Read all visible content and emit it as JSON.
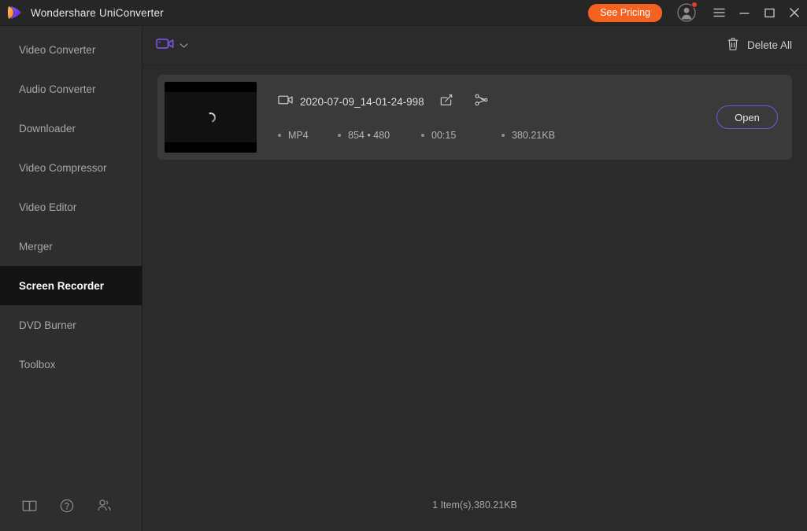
{
  "window": {
    "app_title": "Wondershare UniConverter",
    "logo_icon": "wondershare-play-logo",
    "pricing_label": "See Pricing",
    "avatar_icon": "account-avatar-icon",
    "notification_dot": true,
    "menu_icon": "hamburger-menu-icon",
    "minimize_icon": "minimize-icon",
    "maximize_icon": "maximize-icon",
    "close_icon": "close-icon"
  },
  "sidebar": {
    "items": [
      {
        "label": "Video Converter",
        "active": false
      },
      {
        "label": "Audio Converter",
        "active": false
      },
      {
        "label": "Downloader",
        "active": false
      },
      {
        "label": "Video Compressor",
        "active": false
      },
      {
        "label": "Video Editor",
        "active": false
      },
      {
        "label": "Merger",
        "active": false
      },
      {
        "label": "Screen Recorder",
        "active": true
      },
      {
        "label": "DVD Burner",
        "active": false
      },
      {
        "label": "Toolbox",
        "active": false
      }
    ],
    "footer_icons": [
      {
        "name": "guide-book-icon"
      },
      {
        "name": "help-question-icon"
      },
      {
        "name": "community-users-icon"
      }
    ]
  },
  "toolbar": {
    "recorder_icon": "video-camera-icon",
    "recorder_dropdown_icon": "chevron-down-icon",
    "delete_all_icon": "trash-icon",
    "delete_all_label": "Delete All"
  },
  "file_list": {
    "items": [
      {
        "file_icon": "video-file-icon",
        "name": "2020-07-09_14-01-24-998",
        "edit_icon": "edit-pencil-icon",
        "trim_icon": "trim-cut-icon",
        "thumbnail_state": "loading-spinner",
        "meta": [
          {
            "label": "MP4"
          },
          {
            "label": "854 • 480"
          },
          {
            "label": "00:15"
          },
          {
            "label": "380.21KB"
          }
        ],
        "action_label": "Open"
      }
    ]
  },
  "footer": {
    "summary": "1 Item(s),380.21KB"
  },
  "colors": {
    "accent_purple": "#7b52e0",
    "pricing_orange": "#f4621f",
    "notification_red": "#f0392b",
    "titlebar_bg": "#262626",
    "sidebar_bg": "#2e2e2e",
    "main_bg": "#2b2b2b",
    "card_bg": "#3a3a3a",
    "active_nav_bg": "#141414"
  }
}
